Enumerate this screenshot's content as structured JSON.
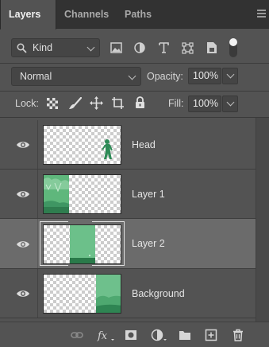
{
  "tabs": [
    {
      "label": "Layers",
      "active": true
    },
    {
      "label": "Channels",
      "active": false
    },
    {
      "label": "Paths",
      "active": false
    }
  ],
  "filter": {
    "kind_label": "Kind",
    "icons": [
      "image-filter-icon",
      "adjustment-filter-icon",
      "type-filter-icon",
      "shape-filter-icon",
      "smart-object-filter-icon",
      "filter-toggle-switch"
    ]
  },
  "blend": {
    "mode": "Normal",
    "opacity_label": "Opacity:",
    "opacity_value": "100%"
  },
  "lock": {
    "label": "Lock:",
    "fill_label": "Fill:",
    "fill_value": "100%"
  },
  "layers": [
    {
      "name": "Head",
      "visible": true,
      "selected": false
    },
    {
      "name": "Layer 1",
      "visible": true,
      "selected": false
    },
    {
      "name": "Layer 2",
      "visible": true,
      "selected": true
    },
    {
      "name": "Background",
      "visible": true,
      "selected": false
    }
  ],
  "bottom_icons": [
    "link-layers-icon",
    "fx-icon",
    "add-mask-icon",
    "adjustment-layer-icon",
    "new-group-icon",
    "new-layer-icon",
    "delete-layer-icon"
  ],
  "colors": {
    "panel_bg": "#535353",
    "selected_row": "#6b6b6b",
    "thumb_green": "#5fb77c"
  }
}
